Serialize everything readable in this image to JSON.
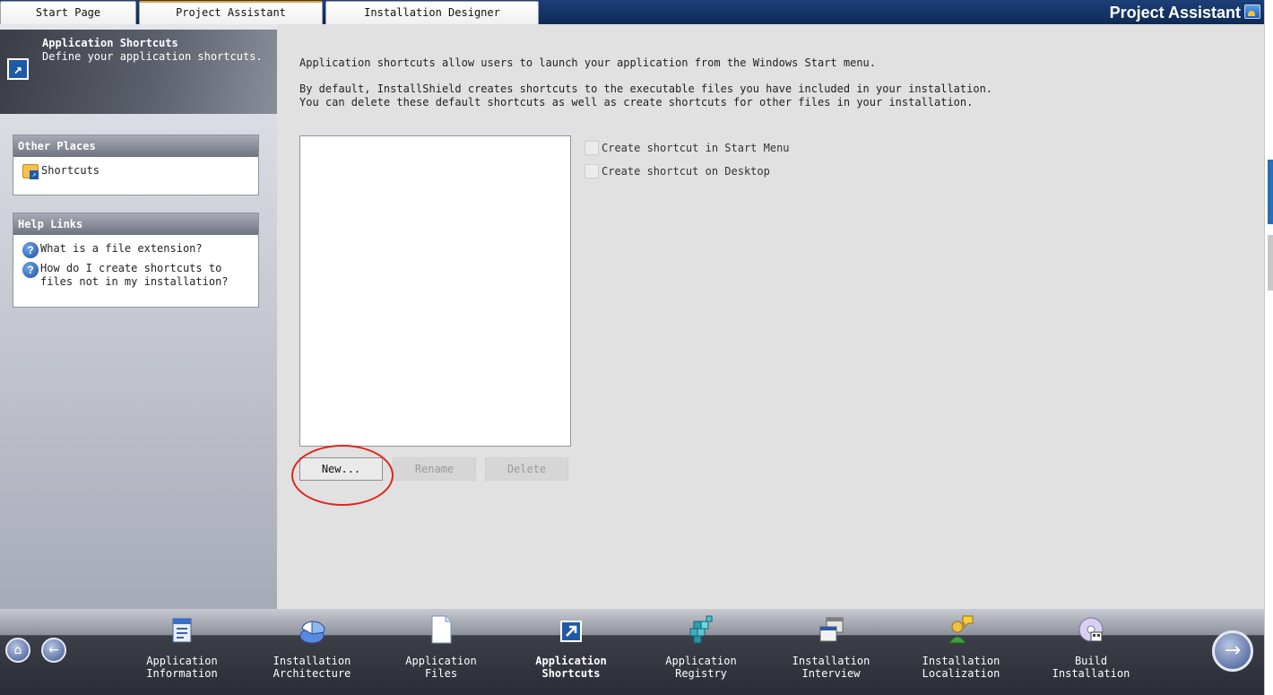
{
  "tabs": [
    {
      "label": "Start Page",
      "active": false
    },
    {
      "label": "Project Assistant",
      "active": true
    },
    {
      "label": "Installation Designer",
      "active": false
    }
  ],
  "tabbar_title": "Project Assistant",
  "sidebar": {
    "header_title": "Application Shortcuts",
    "header_subtitle": "Define your application shortcuts.",
    "other_places": {
      "title": "Other Places",
      "items": [
        "Shortcuts"
      ]
    },
    "help_links": {
      "title": "Help Links",
      "items": [
        "What is a file extension?",
        "How do I create shortcuts to\nfiles not in my installation?"
      ]
    }
  },
  "main": {
    "desc1": "Application shortcuts allow users to launch your application from the Windows Start menu.",
    "desc2": "By default, InstallShield creates shortcuts to the executable files you have included in your installation.\nYou can delete these default shortcuts as well as create shortcuts for other files in your installation.",
    "checkboxes": [
      {
        "label": "Create shortcut in Start Menu",
        "checked": false
      },
      {
        "label": "Create shortcut on Desktop",
        "checked": false
      }
    ],
    "buttons": {
      "new": "New...",
      "rename": "Rename",
      "delete": "Delete"
    }
  },
  "bottom_nav": {
    "steps": [
      {
        "label": "Application\nInformation",
        "icon": "application-information-icon"
      },
      {
        "label": "Installation\nArchitecture",
        "icon": "installation-architecture-icon"
      },
      {
        "label": "Application\nFiles",
        "icon": "application-files-icon"
      },
      {
        "label": "Application\nShortcuts",
        "icon": "application-shortcuts-icon",
        "current": true
      },
      {
        "label": "Application\nRegistry",
        "icon": "application-registry-icon"
      },
      {
        "label": "Installation\nInterview",
        "icon": "installation-interview-icon"
      },
      {
        "label": "Installation\nLocalization",
        "icon": "installation-localization-icon"
      },
      {
        "label": "Build\nInstallation",
        "icon": "build-installation-icon"
      }
    ],
    "home_glyph": "⌂",
    "back_glyph": "←",
    "next_glyph": "→"
  },
  "colors": {
    "tabbar": "#0f2a55",
    "accent_tab": "#f0a020",
    "highlight_circle": "#e0241c"
  }
}
